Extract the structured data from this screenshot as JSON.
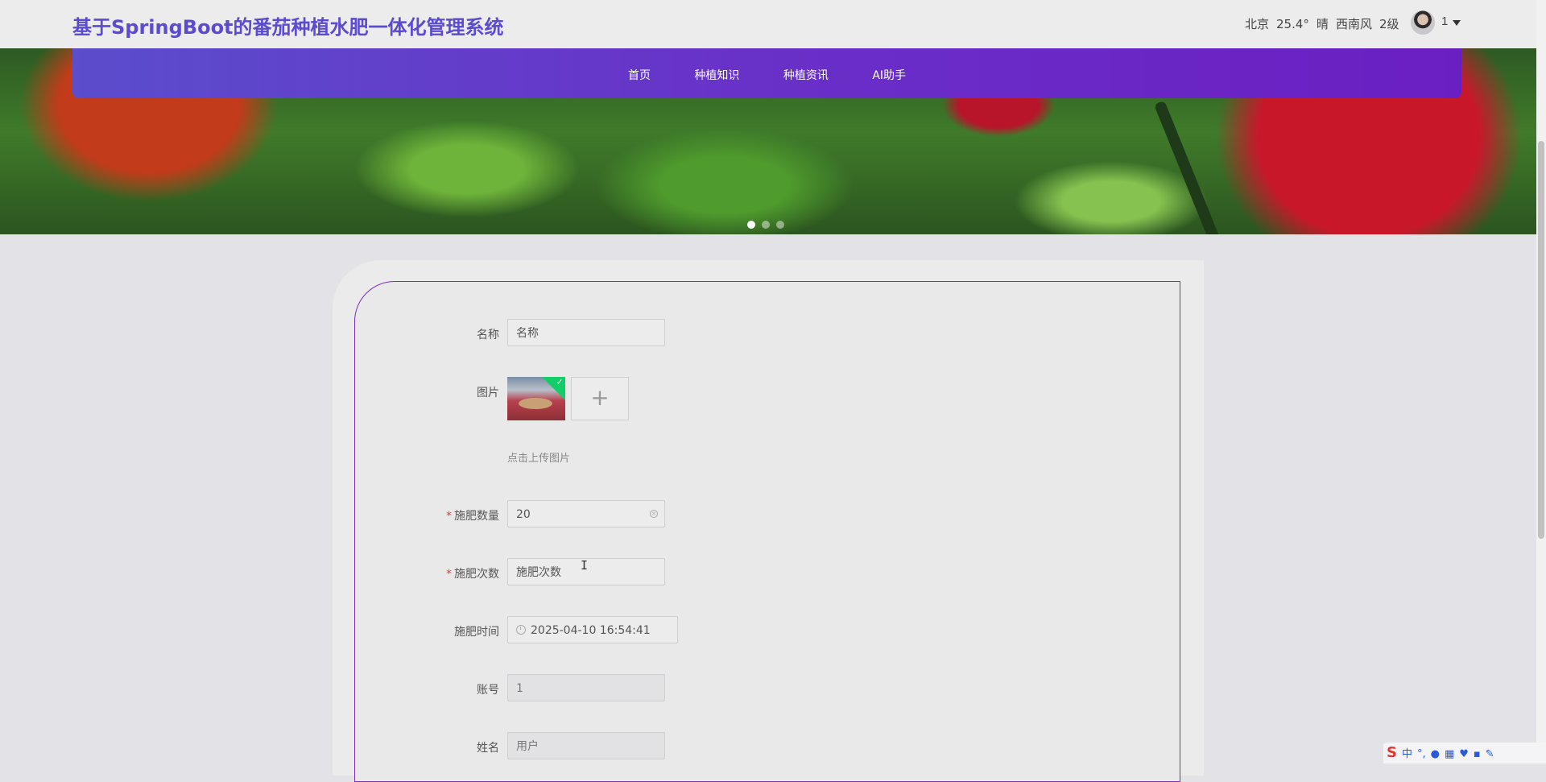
{
  "header": {
    "site_title": "基于SpringBoot的番茄种植水肥一体化管理系统",
    "weather": {
      "city": "北京",
      "temperature": "25.4°",
      "condition": "晴",
      "wind_direction": "西南风",
      "wind_level": "2级"
    },
    "user_name": "1"
  },
  "nav": {
    "items": [
      {
        "label": "首页"
      },
      {
        "label": "种植知识"
      },
      {
        "label": "种植资讯"
      },
      {
        "label": "AI助手"
      }
    ]
  },
  "carousel": {
    "slide_count": 3,
    "active_index": 0
  },
  "form": {
    "name": {
      "label": "名称",
      "placeholder": "名称",
      "value": ""
    },
    "image": {
      "label": "图片",
      "upload_tip": "点击上传图片",
      "add_icon": "plus-icon"
    },
    "fertilize_amount": {
      "label": "施肥数量",
      "required": true,
      "value": "20"
    },
    "fertilize_count": {
      "label": "施肥次数",
      "required": true,
      "placeholder": "施肥次数",
      "value": ""
    },
    "fertilize_time": {
      "label": "施肥时间",
      "value": "2025-04-10 16:54:41"
    },
    "account": {
      "label": "账号",
      "value": "1"
    },
    "real_name": {
      "label": "姓名",
      "value": "用户"
    },
    "required_mark": "*"
  },
  "ime": {
    "brand": "S",
    "mode": "中",
    "punct": "°,",
    "icons": [
      "mic-icon",
      "keyboard-icon",
      "skin-icon",
      "grid-icon",
      "tools-icon"
    ]
  },
  "colors": {
    "title": "#5a4bd0",
    "nav_start": "#5b4dcc",
    "nav_end": "#6a1fc2",
    "card_border": "#7b2fbf",
    "required": "#e23b3b"
  }
}
